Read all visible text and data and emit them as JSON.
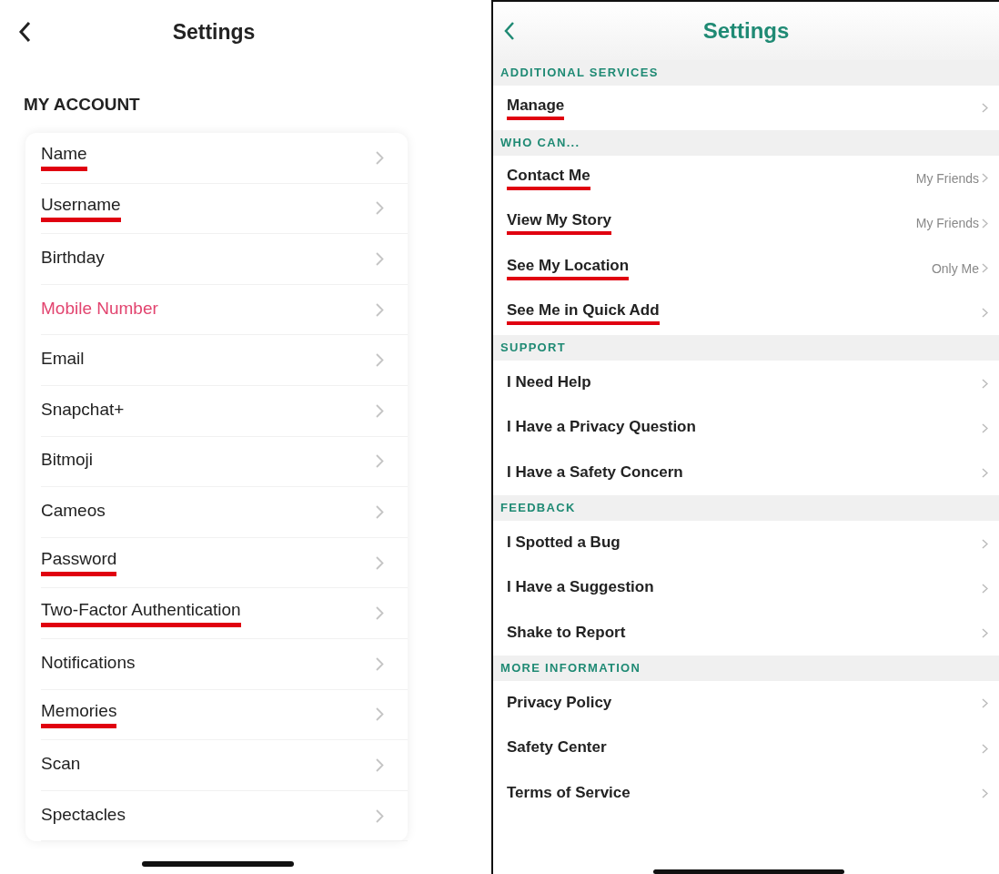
{
  "left": {
    "title": "Settings",
    "section": "MY ACCOUNT",
    "items": [
      {
        "label": "Name",
        "underlined": true,
        "highlighted": false
      },
      {
        "label": "Username",
        "underlined": true,
        "highlighted": false
      },
      {
        "label": "Birthday",
        "underlined": false,
        "highlighted": false
      },
      {
        "label": "Mobile Number",
        "underlined": false,
        "highlighted": true
      },
      {
        "label": "Email",
        "underlined": false,
        "highlighted": false
      },
      {
        "label": "Snapchat+",
        "underlined": false,
        "highlighted": false
      },
      {
        "label": "Bitmoji",
        "underlined": false,
        "highlighted": false
      },
      {
        "label": "Cameos",
        "underlined": false,
        "highlighted": false
      },
      {
        "label": "Password",
        "underlined": true,
        "highlighted": false
      },
      {
        "label": "Two-Factor Authentication",
        "underlined": true,
        "highlighted": false
      },
      {
        "label": "Notifications",
        "underlined": false,
        "highlighted": false
      },
      {
        "label": "Memories",
        "underlined": true,
        "highlighted": false
      },
      {
        "label": "Scan",
        "underlined": false,
        "highlighted": false
      },
      {
        "label": "Spectacles",
        "underlined": false,
        "highlighted": false
      }
    ]
  },
  "right": {
    "title": "Settings",
    "sections": [
      {
        "heading": "ADDITIONAL SERVICES",
        "items": [
          {
            "label": "Manage",
            "underlined": true
          }
        ]
      },
      {
        "heading": "WHO CAN...",
        "items": [
          {
            "label": "Contact Me",
            "value": "My Friends",
            "underlined": true
          },
          {
            "label": "View My Story",
            "value": "My Friends",
            "underlined": true
          },
          {
            "label": "See My Location",
            "value": "Only Me",
            "underlined": true
          },
          {
            "label": "See Me in Quick Add",
            "underlined": true
          }
        ]
      },
      {
        "heading": "SUPPORT",
        "items": [
          {
            "label": "I Need Help",
            "underlined": false
          },
          {
            "label": "I Have a Privacy Question",
            "underlined": false
          },
          {
            "label": "I Have a Safety Concern",
            "underlined": false
          }
        ]
      },
      {
        "heading": "FEEDBACK",
        "items": [
          {
            "label": "I Spotted a Bug",
            "underlined": false
          },
          {
            "label": "I Have a Suggestion",
            "underlined": false
          },
          {
            "label": "Shake to Report",
            "underlined": false
          }
        ]
      },
      {
        "heading": "MORE INFORMATION",
        "items": [
          {
            "label": "Privacy Policy",
            "underlined": false
          },
          {
            "label": "Safety Center",
            "underlined": false
          },
          {
            "label": "Terms of Service",
            "underlined": false
          }
        ]
      }
    ]
  }
}
